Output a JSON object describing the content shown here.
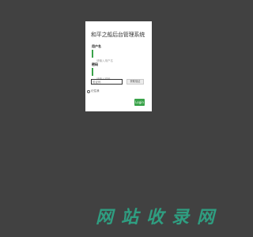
{
  "login": {
    "title": "和平之船后台管理系统",
    "username_label": "用户名",
    "username_placeholder": "请输入用户名",
    "password_label": "密码",
    "password_placeholder": "请输入密码",
    "captcha_placeholder": "验证码",
    "captcha_button": "获取验证",
    "remember_label": "记住我",
    "login_button": "Login",
    "accent_color": "#3aa34a"
  },
  "watermark": {
    "text": [
      "网",
      "站",
      "收",
      "录",
      "网"
    ],
    "color": "#2f9e81"
  }
}
